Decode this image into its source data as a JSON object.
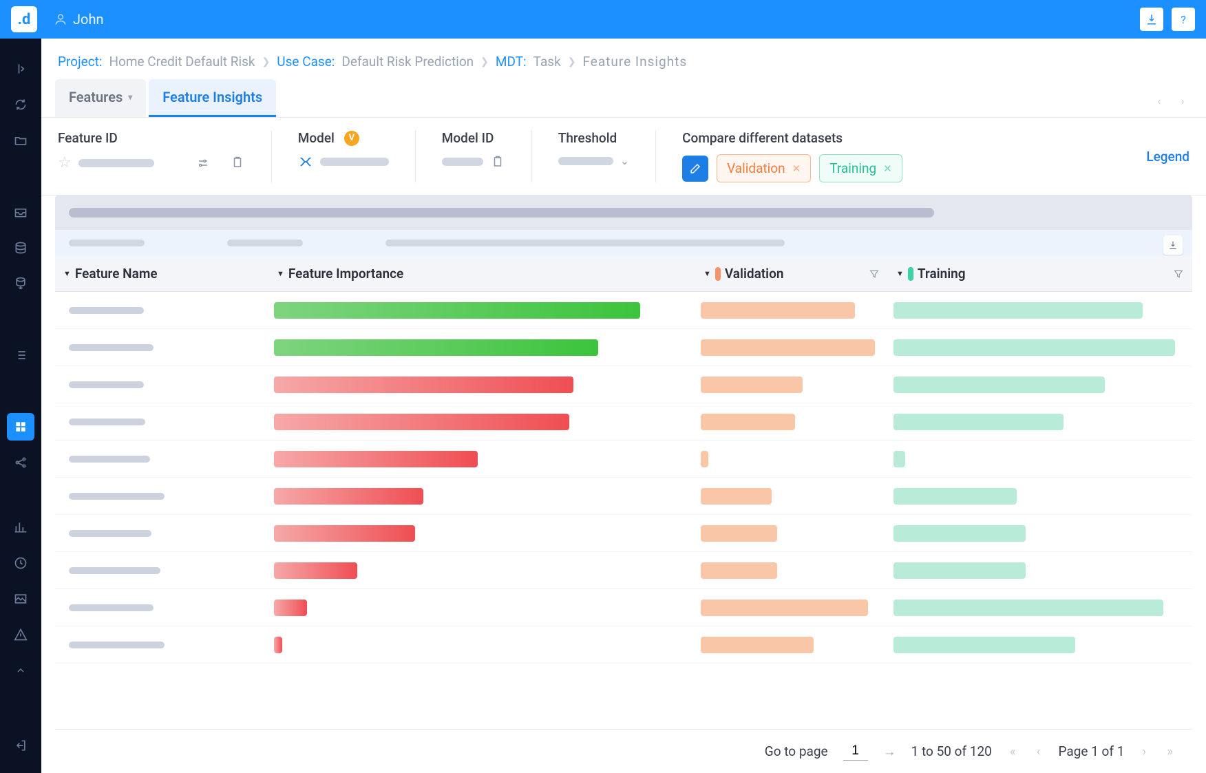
{
  "user": {
    "name": "John"
  },
  "breadcrumb": {
    "project_label": "Project:",
    "project_value": "Home Credit Default Risk",
    "usecase_label": "Use Case:",
    "usecase_value": "Default Risk Prediction",
    "mdt_label": "MDT:",
    "mdt_value": "Task",
    "current": "Feature Insights"
  },
  "tabs": {
    "features": "Features",
    "feature_insights": "Feature Insights"
  },
  "controls": {
    "feature_id": "Feature ID",
    "model": "Model",
    "model_id": "Model ID",
    "threshold": "Threshold",
    "compare": "Compare different datasets",
    "chip_validation": "Validation",
    "chip_training": "Training",
    "legend": "Legend"
  },
  "columns": {
    "feature_name": "Feature Name",
    "feature_importance": "Feature Importance",
    "validation": "Validation",
    "training": "Training"
  },
  "chart_data": {
    "type": "bar",
    "note": "Bar widths read as percentage of column width; no numeric axis labels visible",
    "rows": [
      {
        "importance": {
          "pct": 88,
          "color": "green"
        },
        "validation_pct": 85,
        "training_pct": 85
      },
      {
        "importance": {
          "pct": 78,
          "color": "green"
        },
        "validation_pct": 96,
        "training_pct": 96
      },
      {
        "importance": {
          "pct": 72,
          "color": "red"
        },
        "validation_pct": 56,
        "training_pct": 72
      },
      {
        "importance": {
          "pct": 71,
          "color": "red"
        },
        "validation_pct": 52,
        "training_pct": 58
      },
      {
        "importance": {
          "pct": 49,
          "color": "red"
        },
        "validation_pct": 4,
        "training_pct": 4
      },
      {
        "importance": {
          "pct": 36,
          "color": "red"
        },
        "validation_pct": 39,
        "training_pct": 42
      },
      {
        "importance": {
          "pct": 34,
          "color": "red"
        },
        "validation_pct": 42,
        "training_pct": 45
      },
      {
        "importance": {
          "pct": 20,
          "color": "red"
        },
        "validation_pct": 42,
        "training_pct": 45
      },
      {
        "importance": {
          "pct": 8,
          "color": "red"
        },
        "validation_pct": 92,
        "training_pct": 92
      },
      {
        "importance": {
          "pct": 2,
          "color": "red"
        },
        "validation_pct": 62,
        "training_pct": 62
      }
    ]
  },
  "pagination": {
    "goto_label": "Go to page",
    "goto_value": "1",
    "range": "1 to 50 of 120",
    "page_of": "Page 1 of 1"
  }
}
